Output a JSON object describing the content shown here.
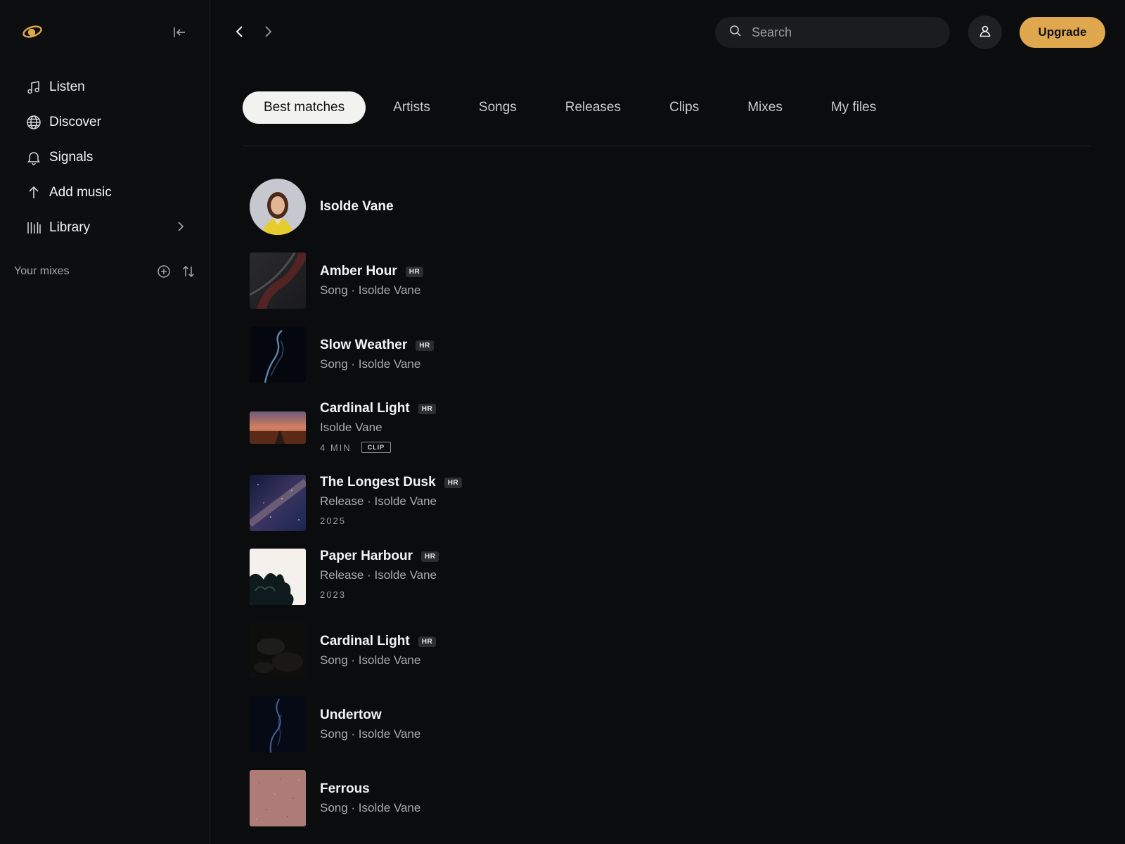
{
  "colors": {
    "accent": "#e0a84e",
    "background": "#0b0c0e",
    "sidebar": "#0d0e10"
  },
  "sidebar": {
    "nav": [
      {
        "label": "Listen",
        "icon": "music-note-icon"
      },
      {
        "label": "Discover",
        "icon": "globe-icon"
      },
      {
        "label": "Signals",
        "icon": "bell-icon"
      },
      {
        "label": "Add music",
        "icon": "arrow-up-icon"
      },
      {
        "label": "Library",
        "icon": "library-icon"
      }
    ],
    "mixes_label": "Your mixes"
  },
  "topbar": {
    "search_placeholder": "Search",
    "upgrade_label": "Upgrade"
  },
  "tabs": [
    "Best matches",
    "Artists",
    "Songs",
    "Releases",
    "Clips",
    "Mixes",
    "My files"
  ],
  "results": [
    {
      "title": "Isolde Vane",
      "type": "artist"
    },
    {
      "title": "Amber Hour",
      "badge": "HR",
      "sub": "Song · Isolde Vane"
    },
    {
      "title": "Slow Weather",
      "badge": "HR",
      "sub": "Song · Isolde Vane"
    },
    {
      "title": "Cardinal Light",
      "badge": "HR",
      "sub": "Isolde Vane",
      "meta": "4 MIN",
      "tag": "CLIP"
    },
    {
      "title": "The Longest Dusk",
      "badge": "HR",
      "sub": "Release · Isolde Vane",
      "meta": "2025"
    },
    {
      "title": "Paper Harbour",
      "badge": "HR",
      "sub": "Release · Isolde Vane",
      "meta": "2023"
    },
    {
      "title": "Cardinal Light",
      "badge": "HR",
      "sub": "Song · Isolde Vane"
    },
    {
      "title": "Undertow",
      "sub": "Song · Isolde Vane"
    },
    {
      "title": "Ferrous",
      "sub": "Song · Isolde Vane"
    }
  ]
}
